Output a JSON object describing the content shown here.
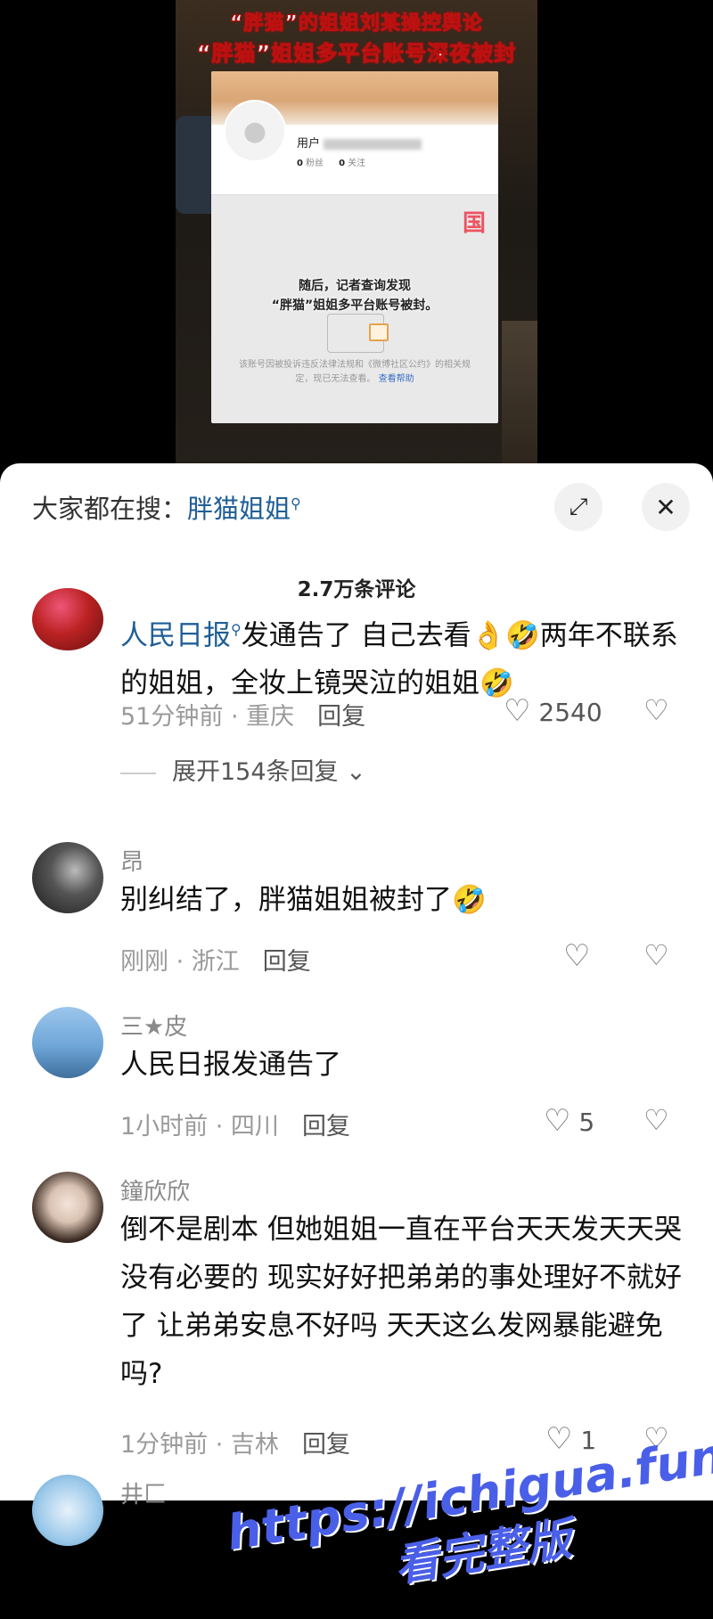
{
  "video": {
    "title_line1": "“胖猫”的姐姐刘某操控舆论",
    "title_line2": "“胖猫”姐姐多平台账号深夜被封",
    "card_user_label": "用户",
    "card_fans": "0",
    "card_fans_label": "粉丝",
    "card_follow": "0",
    "card_follow_label": "关注",
    "card_logo": "国",
    "subtitle_line1": "随后，记者查询发现",
    "subtitle_line2": "“胖猫”姐姐多平台账号被封。",
    "notice": "该账号因被投诉违反法律法规和《微博社区公约》的相关规定，现已无法查看。",
    "notice_link": "查看帮助"
  },
  "search": {
    "label": "大家都在搜：",
    "term": "胖猫姐姐",
    "expand_icon": "expand-icon",
    "close_icon": "close-icon",
    "close_glyph": "✕",
    "expand_glyph": "⤢"
  },
  "comments_count": "2.7万条评论",
  "comments": [
    {
      "name": "",
      "mention": "人民日报",
      "text": "发通告了 自己去看👌🤣两年不联系的姐姐，全妆上镜哭泣的姐姐🤣",
      "time_location": "51分钟前 · 重庆",
      "reply": "回复",
      "likes": "2540",
      "expand": "展开154条回复"
    },
    {
      "name": "昂",
      "text": "别纠结了，胖猫姐姐被封了🤣",
      "time_location": "刚刚 · 浙江",
      "reply": "回复",
      "likes": ""
    },
    {
      "name": "三★皮",
      "text": "人民日报发通告了",
      "time_location": "1小时前 · 四川",
      "reply": "回复",
      "likes": "5"
    },
    {
      "name": "鐘欣欣",
      "text": "倒不是剧本 但她姐姐一直在平台天天发天天哭 没有必要的 现实好好把弟弟的事处理好不就好了 让弟弟安息不好吗 天天这么发网暴能避免吗?",
      "time_location": "1分钟前 · 吉林",
      "reply": "回复",
      "likes": "1"
    },
    {
      "name": "井匚"
    }
  ],
  "watermark": {
    "line1": "https://ichigua.fun",
    "line2": "看完整版",
    "color": "#4a5fe8"
  }
}
